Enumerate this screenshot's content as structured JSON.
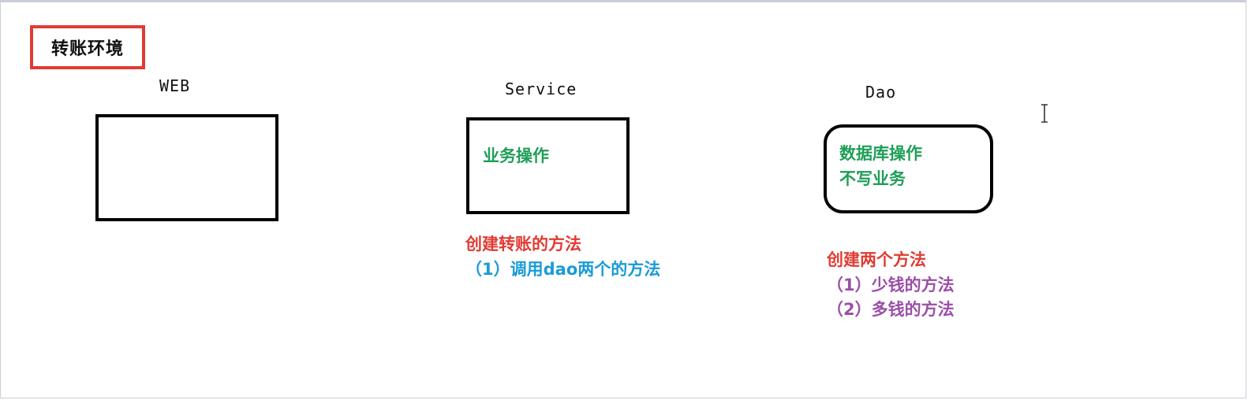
{
  "title": "转账环境",
  "layers": {
    "web": {
      "label": "WEB"
    },
    "service": {
      "label": "Service",
      "box_text": "业务操作"
    },
    "dao": {
      "label": "Dao",
      "box_lines": [
        "数据库操作",
        "不写业务"
      ]
    }
  },
  "service_notes": {
    "heading": "创建转账的方法",
    "item1": "（1）调用dao两个的方法"
  },
  "dao_notes": {
    "heading": "创建两个方法",
    "item1": "（1）少钱的方法",
    "item2": "（2）多钱的方法"
  },
  "colors": {
    "title_border": "#e03b33",
    "box_text": "#1f9e57",
    "heading_red": "#e03b33",
    "blue": "#1a9bd7",
    "purple": "#9b4fa8"
  },
  "icons": {
    "cursor": "text-cursor-icon"
  }
}
